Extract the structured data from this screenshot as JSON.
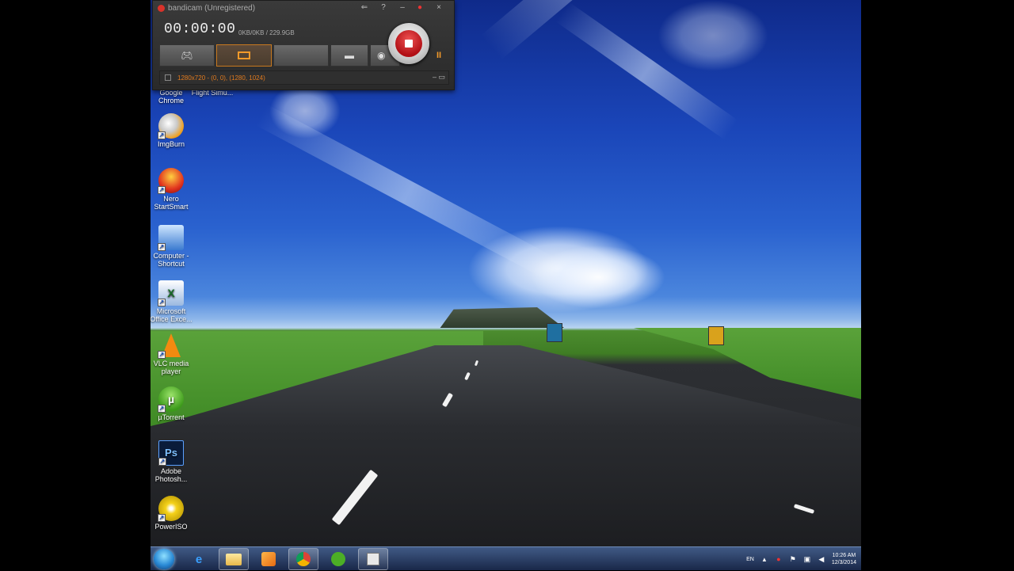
{
  "bandicam": {
    "title": "bandicam (Unregistered)",
    "timer": "00:00:00",
    "size": "0KB/0KB / 229.9GB",
    "status": "1280x720 - (0, 0), (1280, 1024)",
    "minimize": "–",
    "close": "×",
    "pause": "II"
  },
  "desktop": {
    "icons": [
      {
        "label": "Google Chrome",
        "glyph": ""
      },
      {
        "label": "Flight Simu...",
        "glyph": ""
      },
      {
        "label": "ImgBurn",
        "glyph": ""
      },
      {
        "label": "Nero StartSmart",
        "glyph": ""
      },
      {
        "label": "Computer - Shortcut",
        "glyph": ""
      },
      {
        "label": "Microsoft Office Exce...",
        "glyph": ""
      },
      {
        "label": "VLC media player",
        "glyph": ""
      },
      {
        "label": "µTorrent",
        "glyph": "µ"
      },
      {
        "label": "Adobe Photosh...",
        "glyph": "Ps"
      },
      {
        "label": "PowerISO",
        "glyph": ""
      }
    ]
  },
  "taskbar": {
    "language": "EN",
    "time": "10:26 AM",
    "date": "12/3/2014"
  },
  "colors": {
    "accent": "#f39a2a",
    "record": "#c4161c"
  }
}
